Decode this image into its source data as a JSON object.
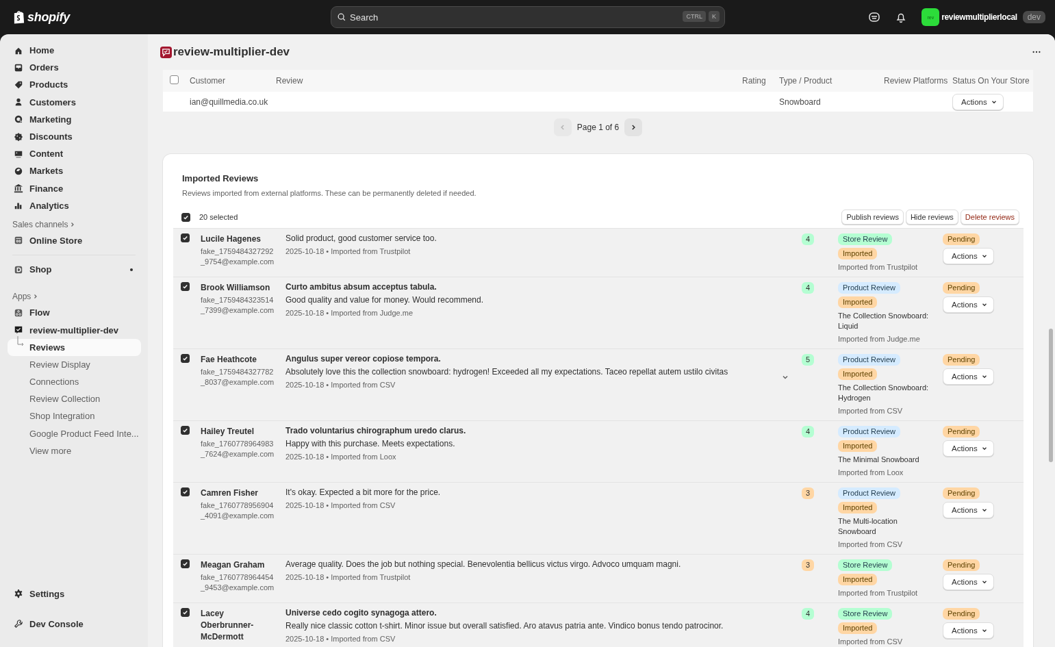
{
  "topbar": {
    "brand": "shopify",
    "search": {
      "placeholder": "Search",
      "keys": [
        "CTRL",
        "K"
      ]
    },
    "avatar": "rev",
    "store": "reviewmultiplierlocal",
    "store_badge": "dev"
  },
  "sidebar": {
    "items": [
      {
        "label": "Home",
        "selected": false
      },
      {
        "label": "Orders",
        "selected": false
      },
      {
        "label": "Products",
        "selected": false
      },
      {
        "label": "Customers",
        "selected": false
      },
      {
        "label": "Marketing",
        "selected": false
      },
      {
        "label": "Discounts",
        "selected": false
      },
      {
        "label": "Content",
        "selected": false
      },
      {
        "label": "Markets",
        "selected": false
      },
      {
        "label": "Finance",
        "selected": false
      },
      {
        "label": "Analytics",
        "selected": false
      }
    ],
    "sales_channels": {
      "heading": "Sales channels",
      "items": [
        {
          "label": "Online Store",
          "selected": false
        }
      ]
    },
    "shop": {
      "label": "Shop",
      "selected": false,
      "dot": true
    },
    "apps": {
      "heading": "Apps",
      "items": [
        {
          "label": "Flow",
          "selected": false
        },
        {
          "label": "review-multiplier-dev",
          "selected": false,
          "children": [
            {
              "label": "Reviews",
              "selected": true
            },
            {
              "label": "Review Display",
              "selected": false
            },
            {
              "label": "Connections",
              "selected": false
            },
            {
              "label": "Review Collection",
              "selected": false
            },
            {
              "label": "Shop Integration",
              "selected": false
            },
            {
              "label": "Google Product Feed Inte...",
              "selected": false
            },
            {
              "label": "View more",
              "selected": false
            }
          ]
        }
      ]
    },
    "bottom": [
      {
        "label": "Settings",
        "selected": false
      },
      {
        "label": "Dev Console",
        "selected": false
      }
    ]
  },
  "page": {
    "title": "review-multiplier-dev"
  },
  "reviews_table": {
    "columns": [
      "Customer",
      "Review",
      "Rating",
      "Type / Product",
      "Review Platforms",
      "Status On Your Store"
    ],
    "select_all_checked": false,
    "partial_row": {
      "email": "ian@quillmedia.co.uk",
      "product": "Snowboard",
      "action": "Actions"
    },
    "pagination": {
      "label": "Page 1 of 6",
      "prev_disabled": true,
      "next_disabled": false
    }
  },
  "imported": {
    "title": "Imported Reviews",
    "description": "Reviews imported from external platforms. These can be permanently deleted if needed.",
    "select_all_checked": true,
    "selected_label": "20 selected",
    "buttons": [
      {
        "label": "Publish reviews",
        "kind": "normal"
      },
      {
        "label": "Hide reviews",
        "kind": "normal"
      },
      {
        "label": "Delete reviews",
        "kind": "danger"
      }
    ],
    "rows": [
      {
        "checked": true,
        "name": "Lucile Hagenes",
        "email": "fake_1759484327292_9754@example.com",
        "title": "",
        "body": "Solid product, good customer service too.",
        "meta": "2025-10-18 • Imported from Trustpilot",
        "expandable": false,
        "rating": {
          "value": "4",
          "color": "#b4fed2"
        },
        "type": {
          "label": "Store Review",
          "color": "#b4fed2"
        },
        "source_tag": "Imported",
        "product": "",
        "platform": "Imported from Trustpilot",
        "status": "Pending",
        "action": "Actions"
      },
      {
        "checked": true,
        "name": "Brook Williamson",
        "email": "fake_1759484323514_7399@example.com",
        "title": "Curto ambitus absum acceptus tabula.",
        "body": "Good quality and value for money. Would recommend.",
        "meta": "2025-10-18 • Imported from Judge.me",
        "expandable": false,
        "rating": {
          "value": "4",
          "color": "#b4fed2"
        },
        "type": {
          "label": "Product Review",
          "color": "#d5ebff"
        },
        "source_tag": "Imported",
        "product": "The Collection Snowboard: Liquid",
        "platform": "Imported from Judge.me",
        "status": "Pending",
        "action": "Actions"
      },
      {
        "checked": true,
        "name": "Fae Heathcote",
        "email": "fake_1759484327782_8037@example.com",
        "title": "Angulus super vereor copiose tempora.",
        "body": "Absolutely love this the collection snowboard: hydrogen! Exceeded all my expectations. Taceo repellat autem ustilo civitas",
        "meta": "2025-10-18 • Imported from CSV",
        "expandable": true,
        "rating": {
          "value": "5",
          "color": "#b4fed2"
        },
        "type": {
          "label": "Product Review",
          "color": "#d5ebff"
        },
        "source_tag": "Imported",
        "product": "The Collection Snowboard: Hydrogen",
        "platform": "Imported from CSV",
        "status": "Pending",
        "action": "Actions"
      },
      {
        "checked": true,
        "name": "Hailey Treutel",
        "email": "fake_1760778964983_7624@example.com",
        "title": "Trado voluntarius chirographum uredo clarus.",
        "body": "Happy with this purchase. Meets expectations.",
        "meta": "2025-10-18 • Imported from Loox",
        "expandable": false,
        "rating": {
          "value": "4",
          "color": "#b4fed2"
        },
        "type": {
          "label": "Product Review",
          "color": "#d5ebff"
        },
        "source_tag": "Imported",
        "product": "The Minimal Snowboard",
        "platform": "Imported from Loox",
        "status": "Pending",
        "action": "Actions"
      },
      {
        "checked": true,
        "name": "Camren Fisher",
        "email": "fake_1760778956904_4091@example.com",
        "title": "",
        "body": "It's okay. Expected a bit more for the price.",
        "meta": "2025-10-18 • Imported from CSV",
        "expandable": false,
        "rating": {
          "value": "3",
          "color": "#ffd6a4"
        },
        "type": {
          "label": "Product Review",
          "color": "#d5ebff"
        },
        "source_tag": "Imported",
        "product": "The Multi-location Snowboard",
        "platform": "Imported from CSV",
        "status": "Pending",
        "action": "Actions"
      },
      {
        "checked": true,
        "name": "Meagan Graham",
        "email": "fake_1760778964454_9453@example.com",
        "title": "",
        "body": "Average quality. Does the job but nothing special. Benevolentia bellicus victus virgo. Advoco umquam magni.",
        "meta": "2025-10-18 • Imported from Trustpilot",
        "expandable": false,
        "rating": {
          "value": "3",
          "color": "#ffd6a4"
        },
        "type": {
          "label": "Store Review",
          "color": "#b4fed2"
        },
        "source_tag": "Imported",
        "product": "",
        "platform": "Imported from Trustpilot",
        "status": "Pending",
        "action": "Actions"
      },
      {
        "checked": true,
        "name": "Lacey Oberbrunner-McDermott",
        "email": "",
        "title": "Universe cedo cogito synagoga attero.",
        "body": "Really nice classic cotton t-shirt. Minor issue but overall satisfied. Aro atavus patria ante. Vindico bonus tendo patrocinor.",
        "meta": "2025-10-18 • Imported from CSV",
        "expandable": false,
        "rating": {
          "value": "4",
          "color": "#b4fed2"
        },
        "type": {
          "label": "Store Review",
          "color": "#b4fed2"
        },
        "source_tag": "Imported",
        "product": "",
        "platform": "Imported from CSV",
        "status": "Pending",
        "action": "Actions"
      }
    ]
  }
}
